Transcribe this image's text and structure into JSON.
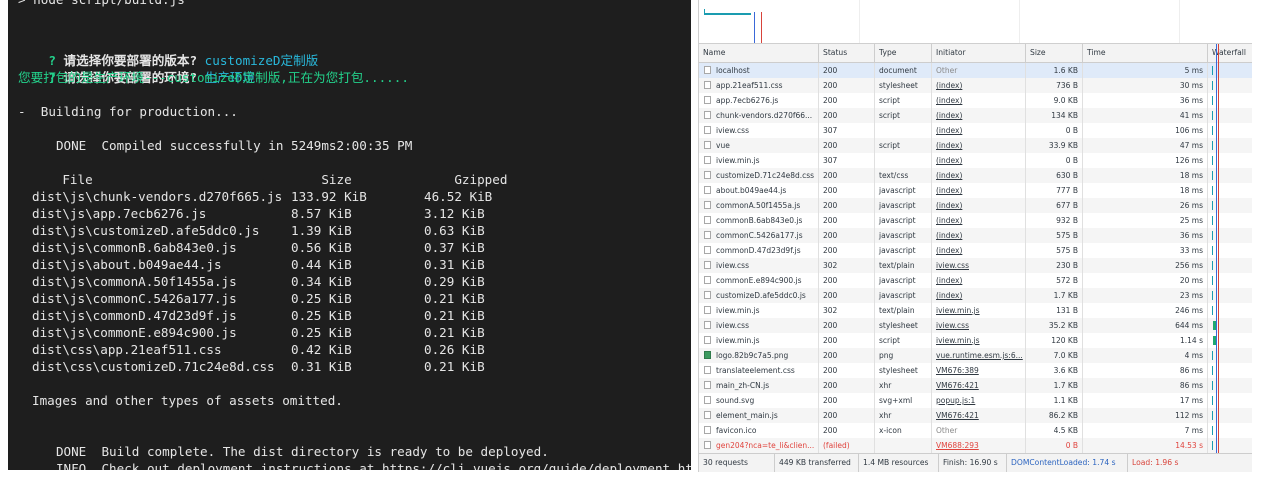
{
  "terminal": {
    "top_cut": "> node script/build.js",
    "q1": {
      "mark": "?",
      "text": "请选择你要部署的版本?",
      "answer": "customizeD定制版"
    },
    "q2": {
      "mark": "?",
      "text": "请选择你要部署的环境?",
      "answer": "生产环境"
    },
    "notice": "您要打包的是生产环境---customizeD定制版,正在为您打包......",
    "building": "-  Building for production...",
    "done_label": "DONE",
    "done_msg": "Compiled successfully in 5249ms2:00:35 PM",
    "table_headers": {
      "file": "File",
      "size": "Size",
      "gzipped": "Gzipped"
    },
    "files": [
      {
        "file": "dist\\js\\chunk-vendors.d270f665.js",
        "size": "133.92 KiB",
        "gzipped": "46.52 KiB"
      },
      {
        "file": "dist\\js\\app.7ecb6276.js",
        "size": "8.57 KiB",
        "gzipped": "3.12 KiB"
      },
      {
        "file": "dist\\js\\customizeD.afe5ddc0.js",
        "size": "1.39 KiB",
        "gzipped": "0.63 KiB"
      },
      {
        "file": "dist\\js\\commonB.6ab843e0.js",
        "size": "0.56 KiB",
        "gzipped": "0.37 KiB"
      },
      {
        "file": "dist\\js\\about.b049ae44.js",
        "size": "0.44 KiB",
        "gzipped": "0.31 KiB"
      },
      {
        "file": "dist\\js\\commonA.50f1455a.js",
        "size": "0.34 KiB",
        "gzipped": "0.29 KiB"
      },
      {
        "file": "dist\\js\\commonC.5426a177.js",
        "size": "0.25 KiB",
        "gzipped": "0.21 KiB"
      },
      {
        "file": "dist\\js\\commonD.47d23d9f.js",
        "size": "0.25 KiB",
        "gzipped": "0.21 KiB"
      },
      {
        "file": "dist\\js\\commonE.e894c900.js",
        "size": "0.25 KiB",
        "gzipped": "0.21 KiB"
      },
      {
        "file": "dist\\css\\app.21eaf511.css",
        "size": "0.42 KiB",
        "gzipped": "0.26 KiB"
      },
      {
        "file": "dist\\css\\customizeD.71c24e8d.css",
        "size": "0.31 KiB",
        "gzipped": "0.21 KiB"
      }
    ],
    "omitted": "Images and other types of assets omitted.",
    "build_done_label": "DONE",
    "build_done_msg": "Build complete. The dist directory is ready to be deployed.",
    "info_label": "INFO",
    "info_msg": "Check out deployment instructions at https://cli.vuejs.org/guide/deployment.html"
  },
  "network": {
    "columns": [
      "Name",
      "Status",
      "Type",
      "Initiator",
      "Size",
      "Time",
      "Waterfall"
    ],
    "rows": [
      {
        "name": "localhost",
        "status": "200",
        "type": "document",
        "initiator": "Other",
        "size": "1.6 KB",
        "time": "5 ms"
      },
      {
        "name": "app.21eaf511.css",
        "status": "200",
        "type": "stylesheet",
        "initiator": "(index)",
        "size": "736 B",
        "time": "30 ms"
      },
      {
        "name": "app.7ecb6276.js",
        "status": "200",
        "type": "script",
        "initiator": "(index)",
        "size": "9.0 KB",
        "time": "36 ms"
      },
      {
        "name": "chunk-vendors.d270f66...",
        "status": "200",
        "type": "script",
        "initiator": "(index)",
        "size": "134 KB",
        "time": "41 ms"
      },
      {
        "name": "iview.css",
        "status": "307",
        "type": "",
        "initiator": "(index)",
        "size": "0 B",
        "time": "106 ms"
      },
      {
        "name": "vue",
        "status": "200",
        "type": "script",
        "initiator": "(index)",
        "size": "33.9 KB",
        "time": "47 ms"
      },
      {
        "name": "iview.min.js",
        "status": "307",
        "type": "",
        "initiator": "(index)",
        "size": "0 B",
        "time": "126 ms"
      },
      {
        "name": "customizeD.71c24e8d.css",
        "status": "200",
        "type": "text/css",
        "initiator": "(index)",
        "size": "630 B",
        "time": "18 ms"
      },
      {
        "name": "about.b049ae44.js",
        "status": "200",
        "type": "javascript",
        "initiator": "(index)",
        "size": "777 B",
        "time": "18 ms"
      },
      {
        "name": "commonA.50f1455a.js",
        "status": "200",
        "type": "javascript",
        "initiator": "(index)",
        "size": "677 B",
        "time": "26 ms"
      },
      {
        "name": "commonB.6ab843e0.js",
        "status": "200",
        "type": "javascript",
        "initiator": "(index)",
        "size": "932 B",
        "time": "25 ms"
      },
      {
        "name": "commonC.5426a177.js",
        "status": "200",
        "type": "javascript",
        "initiator": "(index)",
        "size": "575 B",
        "time": "36 ms"
      },
      {
        "name": "commonD.47d23d9f.js",
        "status": "200",
        "type": "javascript",
        "initiator": "(index)",
        "size": "575 B",
        "time": "33 ms"
      },
      {
        "name": "iview.css",
        "status": "302",
        "type": "text/plain",
        "initiator": "iview.css",
        "size": "230 B",
        "time": "256 ms"
      },
      {
        "name": "commonE.e894c900.js",
        "status": "200",
        "type": "javascript",
        "initiator": "(index)",
        "size": "572 B",
        "time": "20 ms"
      },
      {
        "name": "customizeD.afe5ddc0.js",
        "status": "200",
        "type": "javascript",
        "initiator": "(index)",
        "size": "1.7 KB",
        "time": "23 ms"
      },
      {
        "name": "iview.min.js",
        "status": "302",
        "type": "text/plain",
        "initiator": "iview.min.js",
        "size": "131 B",
        "time": "246 ms"
      },
      {
        "name": "iview.css",
        "status": "200",
        "type": "stylesheet",
        "initiator": "iview.css",
        "size": "35.2 KB",
        "time": "644 ms"
      },
      {
        "name": "iview.min.js",
        "status": "200",
        "type": "script",
        "initiator": "iview.min.js",
        "size": "120 KB",
        "time": "1.14 s"
      },
      {
        "name": "logo.82b9c7a5.png",
        "status": "200",
        "type": "png",
        "initiator": "vue.runtime.esm.js:6...",
        "size": "7.0 KB",
        "time": "4 ms"
      },
      {
        "name": "translateelement.css",
        "status": "200",
        "type": "stylesheet",
        "initiator": "VM676:389",
        "size": "3.6 KB",
        "time": "86 ms"
      },
      {
        "name": "main_zh-CN.js",
        "status": "200",
        "type": "xhr",
        "initiator": "VM676:421",
        "size": "1.7 KB",
        "time": "86 ms"
      },
      {
        "name": "sound.svg",
        "status": "200",
        "type": "svg+xml",
        "initiator": "popup.js:1",
        "size": "1.1 KB",
        "time": "17 ms"
      },
      {
        "name": "element_main.js",
        "status": "200",
        "type": "xhr",
        "initiator": "VM676:421",
        "size": "86.2 KB",
        "time": "112 ms"
      },
      {
        "name": "favicon.ico",
        "status": "200",
        "type": "x-icon",
        "initiator": "Other",
        "size": "4.5 KB",
        "time": "7 ms"
      },
      {
        "name": "gen204?nca=te_li&clien...",
        "status": "(failed)",
        "type": "",
        "initiator": "VM688:293",
        "size": "0 B",
        "time": "14.53 s"
      }
    ],
    "footer": {
      "requests": "30 requests",
      "transferred": "449 KB transferred",
      "resources": "1.4 MB resources",
      "finish": "Finish: 16.90 s",
      "dcl": "DOMContentLoaded: 1.74 s",
      "load": "Load: 1.96 s"
    }
  },
  "colors": {
    "terminal_bg": "#1e1e1e",
    "terminal_green": "#23d18b",
    "terminal_cyan": "#29b8db",
    "dcl_blue": "#2d65c0",
    "load_red": "#d8433a"
  }
}
